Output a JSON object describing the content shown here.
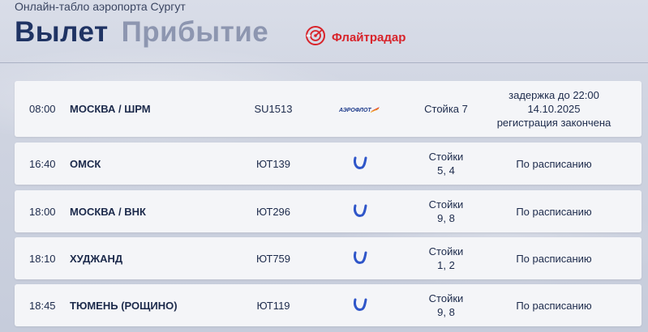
{
  "header": {
    "subtitle": "Онлайн-табло аэропорта Сургут",
    "tabs": [
      {
        "label": "Вылет",
        "active": true
      },
      {
        "label": "Прибытие",
        "active": false
      }
    ],
    "flightradar_label": "Флайтрадар"
  },
  "colors": {
    "accent_red": "#d8232a",
    "navy": "#1f3363",
    "utair_blue": "#2f56c9",
    "aeroflot_blue": "#1d3a8a"
  },
  "flights": [
    {
      "time": "08:00",
      "destination": "МОСКВА / ШРМ",
      "flight": "SU1513",
      "airline_logo": "aeroflot-logo",
      "checkin": "Стойка 7",
      "status": "задержка до 22:00\n14.10.2025\nрегистрация закончена"
    },
    {
      "time": "16:40",
      "destination": "ОМСК",
      "flight": "ЮТ139",
      "airline_logo": "utair-logo",
      "checkin": "Стойки\n5, 4",
      "status": "По расписанию"
    },
    {
      "time": "18:00",
      "destination": "МОСКВА / ВНК",
      "flight": "ЮТ296",
      "airline_logo": "utair-logo",
      "checkin": "Стойки\n9, 8",
      "status": "По расписанию"
    },
    {
      "time": "18:10",
      "destination": "ХУДЖАНД",
      "flight": "ЮТ759",
      "airline_logo": "utair-logo",
      "checkin": "Стойки\n1, 2",
      "status": "По расписанию"
    },
    {
      "time": "18:45",
      "destination": "ТЮМЕНЬ (РОЩИНО)",
      "flight": "ЮТ119",
      "airline_logo": "utair-logo",
      "checkin": "Стойки\n9, 8",
      "status": "По расписанию"
    }
  ]
}
